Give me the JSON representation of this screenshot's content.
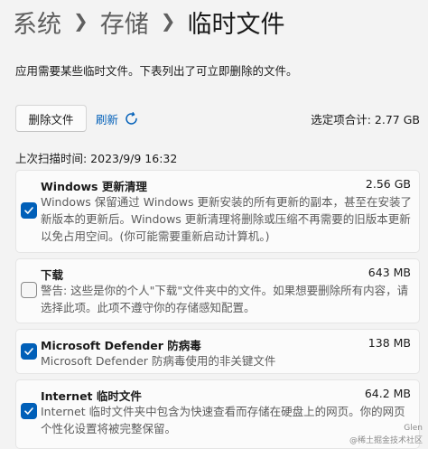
{
  "breadcrumb": [
    "系统",
    "存储",
    "临时文件"
  ],
  "description": "应用需要某些临时文件。下表列出了可立即删除的文件。",
  "toolbar": {
    "delete_label": "删除文件",
    "refresh_label": "刷新",
    "selected_total": "选定项合计: 2.77 GB"
  },
  "scan_time": "上次扫描时间: 2023/9/9 16:32",
  "items": [
    {
      "title": "Windows 更新清理",
      "size": "2.56 GB",
      "checked": true,
      "description": "Windows 保留通过 Windows 更新安装的所有更新的副本，甚至在安装了新版本的更新后。Windows 更新清理将删除或压缩不再需要的旧版本更新以免占用空间。(你可能需要重新启动计算机。)"
    },
    {
      "title": "下载",
      "size": "643 MB",
      "checked": false,
      "description": "警告: 这些是你的个人\"下载\"文件夹中的文件。如果想要删除所有内容，请选择此项。此项不遵守你的存储感知配置。"
    },
    {
      "title": "Microsoft Defender 防病毒",
      "size": "138 MB",
      "checked": true,
      "description": "Microsoft Defender 防病毒使用的非关键文件"
    },
    {
      "title": "Internet 临时文件",
      "size": "64.2 MB",
      "checked": true,
      "description": "Internet 临时文件夹中包含为快速查看而存储在硬盘上的网页。你的网页个性化设置将被完整保留。"
    }
  ],
  "watermark": {
    "author": "Glen",
    "site": "@稀土掘金技术社区"
  },
  "colors": {
    "accent": "#005fb8",
    "background": "#f3f3f3",
    "card": "#fbfbfb"
  },
  "icons": [
    "chevron-right-icon",
    "refresh-icon",
    "checkmark-icon"
  ]
}
